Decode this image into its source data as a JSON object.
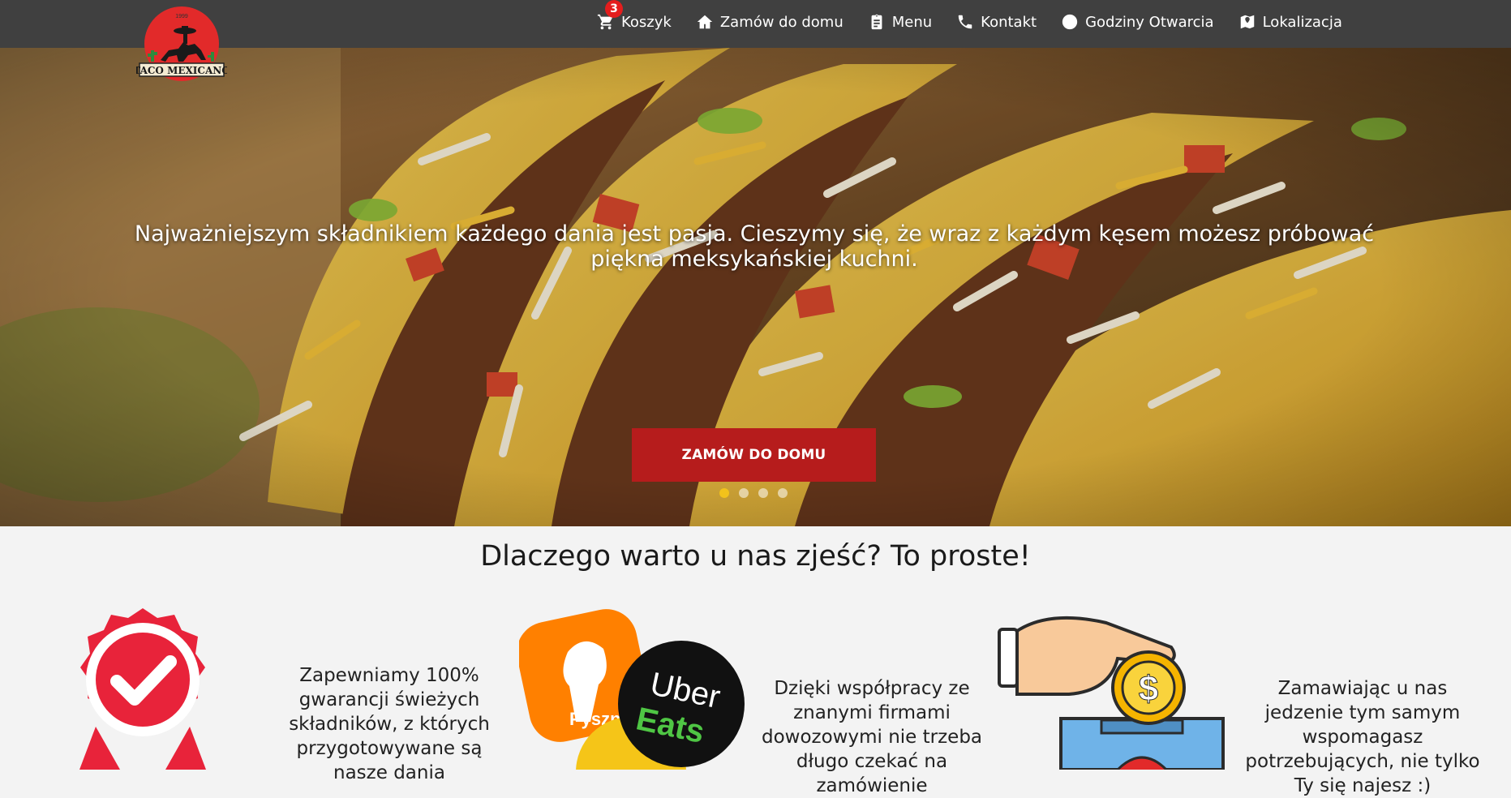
{
  "brand": {
    "logo_text": "TACO MEXICANO",
    "logo_year": "1999"
  },
  "nav": {
    "cart_badge": "3",
    "items": [
      {
        "label": "Koszyk",
        "icon": "cart-icon"
      },
      {
        "label": "Zamów do domu",
        "icon": "home-icon"
      },
      {
        "label": "Menu",
        "icon": "clipboard-icon"
      },
      {
        "label": "Kontakt",
        "icon": "phone-icon"
      },
      {
        "label": "Godziny Otwarcia",
        "icon": "clock-icon"
      },
      {
        "label": "Lokalizacja",
        "icon": "map-icon"
      }
    ]
  },
  "hero": {
    "text": "Najważniejszym składnikiem każdego dania jest pasja. Cieszymy się, że wraz z każdym kęsem możesz próbować piękna meksykańskiej kuchni.",
    "button": "ZAMÓW DO DOMU",
    "slides": 4,
    "active_slide": 1
  },
  "why": {
    "title": "Dlaczego warto u nas zjeść? To proste!",
    "features": [
      {
        "icon": "quality-badge-icon",
        "text": "Zapewniamy 100% gwarancji świeżych składników, z których przygotowywane są nasze dania"
      },
      {
        "icon": "delivery-partners-icon",
        "logos": [
          "Pyszne",
          "Uber Eats"
        ],
        "text": "Dzięki współpracy ze znanymi firmami dowozowymi nie trzeba długo czekać na zamówienie"
      },
      {
        "icon": "donation-icon",
        "text": "Zamawiając u nas jedzenie tym samym wspomagasz potrzebujących, nie tylko Ty się najesz :)"
      }
    ]
  },
  "colors": {
    "navbar": "#404040",
    "accent_red": "#b61c1c",
    "badge_red": "#e41d1d",
    "active_dot": "#f2c21b",
    "page_bg": "#f3f3f3"
  }
}
